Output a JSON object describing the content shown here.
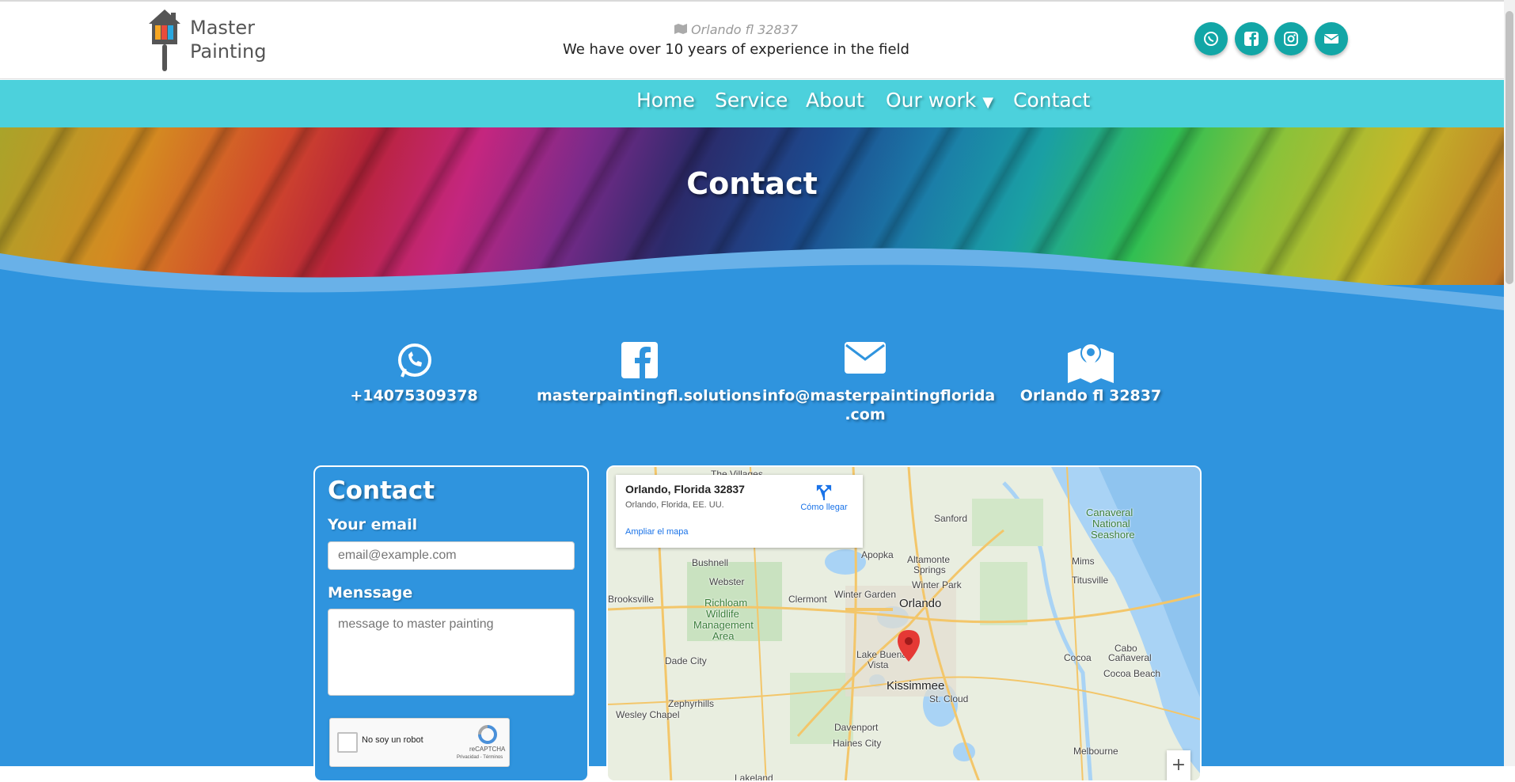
{
  "header": {
    "logo_line1": "Master",
    "logo_line2": "Painting",
    "location": "Orlando fl 32837",
    "tagline": "We have over 10 years of experience in the field",
    "social": [
      {
        "icon": "whatsapp-icon"
      },
      {
        "icon": "facebook-icon"
      },
      {
        "icon": "instagram-icon"
      },
      {
        "icon": "email-icon"
      }
    ],
    "social_color": "#12a6a6"
  },
  "nav": {
    "items": [
      "Home",
      "Service",
      "About",
      "Our work",
      "Contact"
    ],
    "color": "#4cd1dc"
  },
  "hero": {
    "title": "Contact"
  },
  "contacts": [
    {
      "icon": "whatsapp-icon",
      "text": "+14075309378"
    },
    {
      "icon": "facebook-icon",
      "text": "masterpaintingfl.solutions"
    },
    {
      "icon": "envelope-icon",
      "text_line1": "info@masterpaintingflorida",
      "text_line2": ".com"
    },
    {
      "icon": "map-marker-icon",
      "text": "Orlando fl 32837"
    }
  ],
  "form": {
    "title": "Contact",
    "email_label": "Your email",
    "email_placeholder": "email@example.com",
    "message_label": "Menssage",
    "message_placeholder": "message to master painting",
    "recaptcha_label": "No soy un robot",
    "recaptcha_brand": "reCAPTCHA",
    "recaptcha_links": "Privacidad - Términos"
  },
  "map": {
    "card_title": "Orlando, Florida 32837",
    "card_subtitle": "Orlando, Florida, EE. UU.",
    "directions_label": "Cómo llegar",
    "enlarge_label": "Ampliar el mapa",
    "zoom_in": "+",
    "cities": {
      "orlando": "Orlando",
      "sanford": "Sanford",
      "apopka": "Apopka",
      "altamonte": "Altamonte",
      "springs": "Springs",
      "winter_park": "Winter Park",
      "winter_garden": "Winter Garden",
      "clermont": "Clermont",
      "kissimmee": "Kissimmee",
      "st_cloud": "St. Cloud",
      "lake_buena": "Lake Buena",
      "vista": "Vista",
      "davenport": "Davenport",
      "haines_city": "Haines City",
      "titusville": "Titusville",
      "mims": "Mims",
      "cocoa": "Cocoa",
      "cocoa_beach": "Cocoa Beach",
      "cabo1": "Cabo",
      "cabo2": "Cañaveral",
      "canaveral1": "Canaveral",
      "canaveral2": "National",
      "canaveral3": "Seashore",
      "bushnell": "Bushnell",
      "webster": "Webster",
      "brooksville": "Brooksville",
      "richloam1": "Richloam",
      "richloam2": "Wildlife",
      "richloam3": "Management",
      "richloam4": "Area",
      "dade_city": "Dade City",
      "zephyrhills": "Zephyrhills",
      "wesley_chapel": "Wesley Chapel",
      "melbourne": "Melbourne",
      "the_villages": "The Villages",
      "lakeland": "Lakeland"
    }
  }
}
